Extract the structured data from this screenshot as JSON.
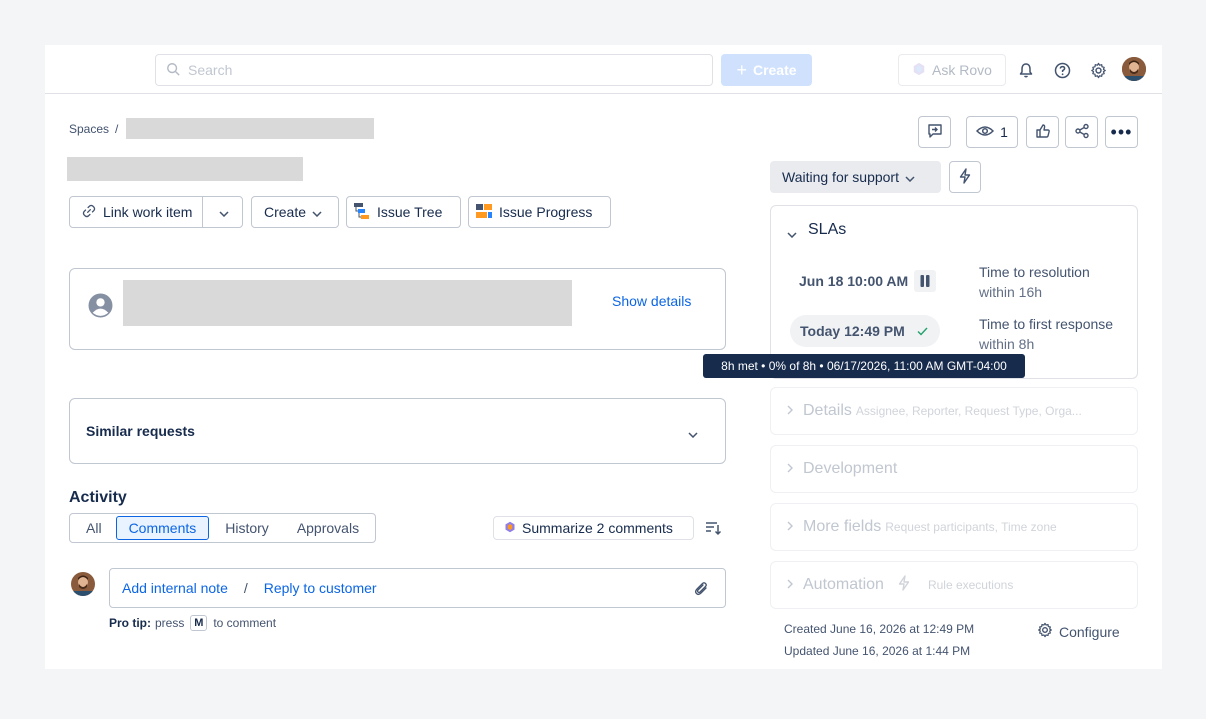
{
  "topnav": {
    "search_placeholder": "Search",
    "create_label": "Create",
    "ask_rovo_label": "Ask Rovo"
  },
  "breadcrumb": {
    "root": "Spaces",
    "separator": "/"
  },
  "header_actions": {
    "watchers_count": "1"
  },
  "actions": {
    "link_work_item": "Link work item",
    "create": "Create",
    "issue_tree": "Issue Tree",
    "issue_progress": "Issue Progress"
  },
  "reporter_card": {
    "show_details": "Show details"
  },
  "similar_requests": {
    "title": "Similar requests"
  },
  "activity": {
    "title": "Activity",
    "tabs": [
      "All",
      "Comments",
      "History",
      "Approvals"
    ],
    "summarize_label": "Summarize 2 comments",
    "add_internal_note": "Add internal note",
    "separator": "/",
    "reply_to_customer": "Reply to customer",
    "pro_tip_label": "Pro tip:",
    "pro_tip_press": "press",
    "pro_tip_key": "M",
    "pro_tip_suffix": "to comment"
  },
  "status": {
    "label": "Waiting for support"
  },
  "slas": {
    "title": "SLAs",
    "items": [
      {
        "time": "Jun 18 10:00 AM",
        "name": "Time to resolution",
        "goal": "within 16h"
      },
      {
        "time": "Today 12:49 PM",
        "name": "Time to first response",
        "goal": "within 8h"
      }
    ],
    "tooltip": "8h met • 0% of 8h • 06/17/2026, 11:00 AM GMT-04:00"
  },
  "sidebar_sections": {
    "details": {
      "title": "Details",
      "sub": "Assignee, Reporter, Request Type, Orga..."
    },
    "development": {
      "title": "Development"
    },
    "more_fields": {
      "title": "More fields",
      "sub": "Request participants, Time zone"
    },
    "automation": {
      "title": "Automation",
      "sub": "Rule executions"
    }
  },
  "meta": {
    "created": "Created June 16, 2026 at 12:49 PM",
    "updated": "Updated June 16, 2026 at 1:44 PM",
    "configure": "Configure"
  },
  "colors": {
    "link": "#0c66e4",
    "primary_disabled": "#cfe1fd",
    "border": "#c1c7d0",
    "success": "#22a06b",
    "tooltip_bg": "#172b4d"
  }
}
